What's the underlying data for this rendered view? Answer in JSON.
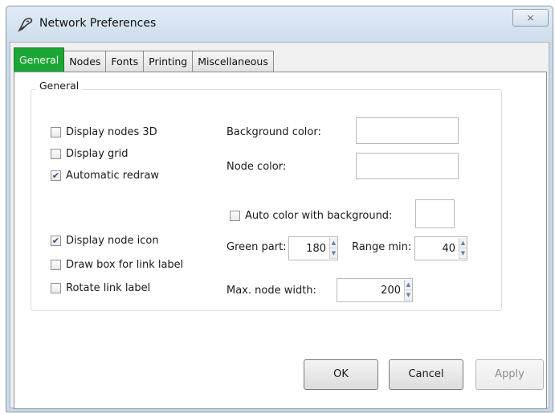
{
  "window": {
    "title": "Network Preferences",
    "close_label": "⨯"
  },
  "tabs": [
    {
      "label": "General"
    },
    {
      "label": "Nodes"
    },
    {
      "label": "Fonts"
    },
    {
      "label": "Printing"
    },
    {
      "label": "Miscellaneous"
    }
  ],
  "general": {
    "group_label": "General",
    "checkboxes": [
      {
        "label": "Display nodes 3D",
        "checked": false
      },
      {
        "label": "Display grid",
        "checked": false
      },
      {
        "label": "Automatic redraw",
        "checked": true
      },
      {
        "label": "Display node icon",
        "checked": true
      },
      {
        "label": "Draw box for link label",
        "checked": false
      },
      {
        "label": "Rotate link label",
        "checked": false
      }
    ],
    "background_color_label": "Background color:",
    "node_color_label": "Node color:",
    "auto_color": {
      "label": "Auto color with background:",
      "checked": false
    },
    "green_part": {
      "label": "Green part:",
      "value": "180"
    },
    "range_min": {
      "label": "Range min:",
      "value": "40"
    },
    "max_node_width": {
      "label": "Max. node width:",
      "value": "200"
    }
  },
  "buttons": {
    "ok": "OK",
    "cancel": "Cancel",
    "apply": "Apply"
  },
  "colors": {
    "active_tab": "#1ca636",
    "window_frame": "#c9d9ea"
  },
  "icons": {
    "app": "pen-nib-icon",
    "close": "close-icon",
    "check": "checkmark-icon"
  }
}
